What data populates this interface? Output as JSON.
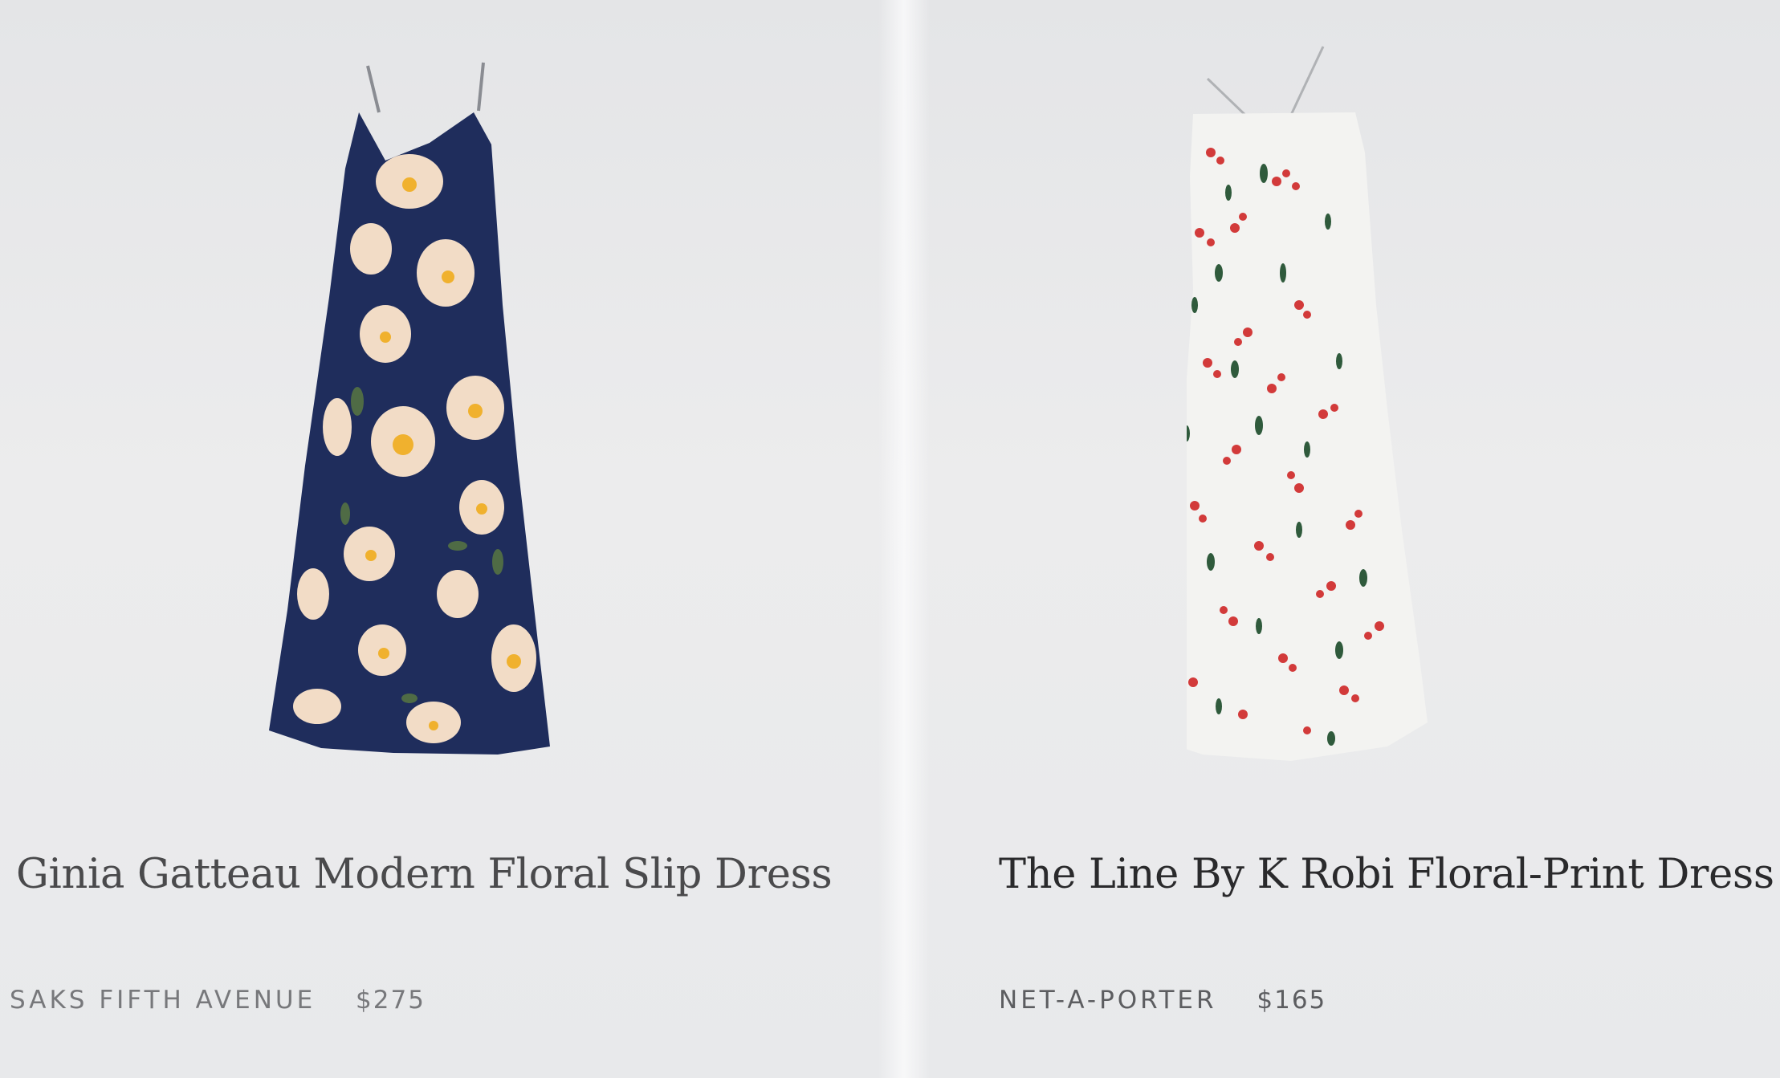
{
  "products": [
    {
      "title": "Ginia Gatteau Modern Floral Slip Dress",
      "retailer": "SAKS FIFTH AVENUE",
      "price": "$275",
      "image_icon": "navy-floral-slip-dress-image",
      "colors": {
        "fabric": "#1f2d5c",
        "flower": "#f2dcc6",
        "center": "#f0b12e",
        "leaf": "#4f6b45"
      }
    },
    {
      "title": "The Line By K Robi Floral-Print Dress",
      "retailer": "NET-A-PORTER",
      "price": "$165",
      "image_icon": "white-floral-print-dress-image",
      "colors": {
        "fabric": "#f3f3f1",
        "flower": "#d23a3a",
        "leaf": "#2f5a3c"
      }
    }
  ]
}
